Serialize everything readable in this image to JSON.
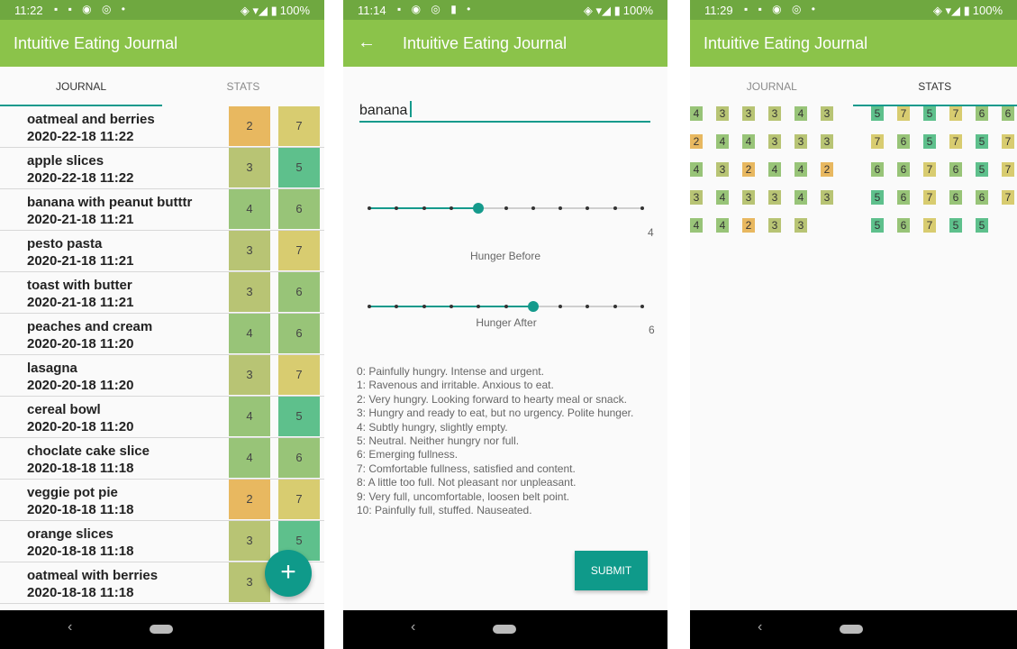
{
  "colors": {
    "c2": "#e8b860",
    "c3": "#b8c474",
    "c4": "#98c478",
    "c5": "#5ec08c",
    "c6": "#98c478",
    "c7": "#d8cc70",
    "accent": "#159a8c",
    "appbar": "#8bc34a"
  },
  "screen1": {
    "status": {
      "time": "11:22",
      "icons": "▪ ▪ ◉ ◎ •",
      "battery": "100%"
    },
    "title": "Intuitive Eating Journal",
    "tabs": [
      "JOURNAL",
      "STATS"
    ],
    "fab_label": "+",
    "entries": [
      {
        "name": "oatmeal and berries",
        "date": "2020-22-18 11:22",
        "before": "2",
        "after": "7"
      },
      {
        "name": "apple slices",
        "date": "2020-22-18 11:22",
        "before": "3",
        "after": "5"
      },
      {
        "name": "banana with peanut butttr",
        "date": "2020-21-18 11:21",
        "before": "4",
        "after": "6"
      },
      {
        "name": "pesto pasta",
        "date": "2020-21-18 11:21",
        "before": "3",
        "after": "7"
      },
      {
        "name": "toast with butter",
        "date": "2020-21-18 11:21",
        "before": "3",
        "after": "6"
      },
      {
        "name": "peaches and cream",
        "date": "2020-20-18 11:20",
        "before": "4",
        "after": "6"
      },
      {
        "name": "lasagna",
        "date": "2020-20-18 11:20",
        "before": "3",
        "after": "7"
      },
      {
        "name": "cereal bowl",
        "date": "2020-20-18 11:20",
        "before": "4",
        "after": "5"
      },
      {
        "name": "choclate cake slice",
        "date": "2020-18-18 11:18",
        "before": "4",
        "after": "6"
      },
      {
        "name": "veggie pot pie",
        "date": "2020-18-18 11:18",
        "before": "2",
        "after": "7"
      },
      {
        "name": "orange slices",
        "date": "2020-18-18 11:18",
        "before": "3",
        "after": "5"
      },
      {
        "name": "oatmeal with berries",
        "date": "2020-18-18 11:18",
        "before": "3",
        "after": ""
      }
    ]
  },
  "screen2": {
    "status": {
      "time": "11:14",
      "icons": "▪ ◉ ◎ ▮ •",
      "battery": "100%"
    },
    "title": "Intuitive Eating Journal",
    "food_value": "banana",
    "hunger_before": {
      "label": "Hunger Before",
      "value": 4,
      "max": 10
    },
    "hunger_after": {
      "label": "Hunger After",
      "value": 6,
      "max": 10
    },
    "scale": [
      "0: Painfully hungry. Intense and urgent.",
      "1: Ravenous and irritable. Anxious to eat.",
      "2: Very hungry. Looking forward to hearty meal or snack.",
      "3: Hungry and ready to eat, but no urgency. Polite hunger.",
      "4: Subtly hungry, slightly empty.",
      "5: Neutral. Neither hungry nor full.",
      "6: Emerging fullness.",
      "7: Comfortable fullness, satisfied and content.",
      "8: A little too full. Not pleasant nor unpleasant.",
      "9: Very full, uncomfortable, loosen belt point.",
      "10: Painfully full, stuffed. Nauseated."
    ],
    "submit_label": "SUBMIT"
  },
  "screen3": {
    "status": {
      "time": "11:29",
      "icons": "▪ ▪ ◉ ◎ •",
      "battery": "100%"
    },
    "title": "Intuitive Eating Journal",
    "tabs": [
      "JOURNAL",
      "STATS"
    ],
    "before_rows": [
      [
        "4",
        "3",
        "3",
        "3",
        "4",
        "3"
      ],
      [
        "2",
        "4",
        "4",
        "3",
        "3",
        "3"
      ],
      [
        "4",
        "3",
        "2",
        "4",
        "4",
        "2"
      ],
      [
        "3",
        "4",
        "3",
        "3",
        "4",
        "3"
      ],
      [
        "4",
        "4",
        "2",
        "3",
        "3"
      ]
    ],
    "after_rows": [
      [
        "5",
        "7",
        "5",
        "7",
        "6",
        "6"
      ],
      [
        "7",
        "6",
        "5",
        "7",
        "5",
        "7"
      ],
      [
        "6",
        "6",
        "7",
        "6",
        "5",
        "7"
      ],
      [
        "5",
        "6",
        "7",
        "6",
        "6",
        "7"
      ],
      [
        "5",
        "6",
        "7",
        "5",
        "5"
      ]
    ]
  }
}
